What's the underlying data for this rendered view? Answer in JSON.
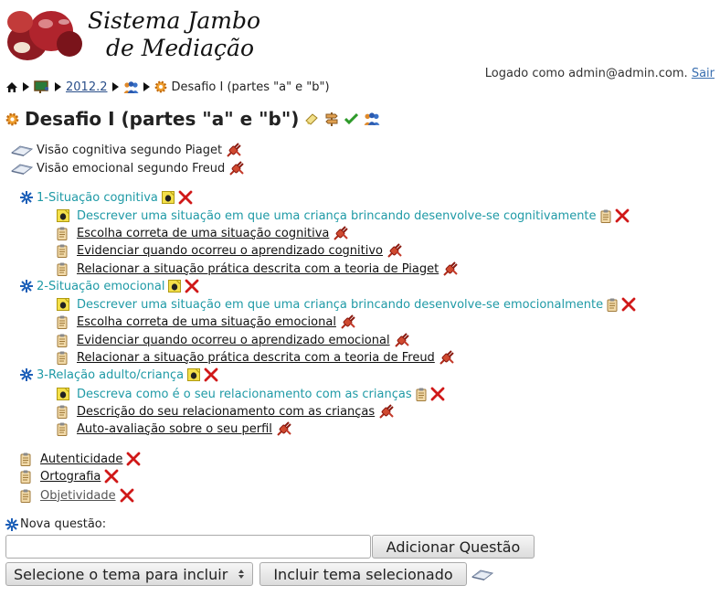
{
  "brand": {
    "line1": "Sistema Jambo",
    "line2": "de Mediação"
  },
  "login": {
    "text": "Logado como admin@admin.com.",
    "logout": "Sair"
  },
  "breadcrumb": {
    "semester": "2012.2",
    "current": "Desafio I (partes \"a\" e \"b\")"
  },
  "title": "Desafio I (partes \"a\" e \"b\")",
  "references": [
    {
      "label": "Visão cognitiva segundo Piaget"
    },
    {
      "label": "Visão emocional segundo Freud"
    }
  ],
  "situations": [
    {
      "label": "1-Situação cognitiva",
      "question": "Descrever uma situação em que uma criança brincando desenvolve-se cognitivamente",
      "criteria": [
        "Escolha correta de uma situação cognitiva",
        "Evidenciar quando ocorreu o aprendizado cognitivo",
        "Relacionar a situação prática descrita com a teoria de Piaget"
      ]
    },
    {
      "label": "2-Situação emocional",
      "question": "Descrever uma situação em que uma criança brincando desenvolve-se emocionalmente",
      "criteria": [
        "Escolha correta de uma situação emocional",
        "Evidenciar quando ocorreu o aprendizado emocional",
        "Relacionar a situação prática descrita com a teoria de Freud"
      ]
    },
    {
      "label": "3-Relação adulto/criança",
      "question": "Descreva como é o seu relacionamento com as crianças",
      "criteria": [
        "Descrição do seu relacionamento com as crianças",
        "Auto-avaliação sobre o seu perfil"
      ]
    }
  ],
  "general_criteria": [
    "Autenticidade",
    "Ortografia",
    "Objetividade"
  ],
  "form": {
    "new_question_label": "Nova questão:",
    "new_question_value": "",
    "add_button": "Adicionar Questão",
    "theme_select": "Selecione o tema para incluir",
    "include_button": "Incluir tema selecionado"
  },
  "icons": {
    "home": "home-icon",
    "classroom": "classroom-icon",
    "group": "group-icon",
    "gear": "gear-icon",
    "book": "book-icon",
    "plug": "plug-icon",
    "clipboard": "clipboard-icon",
    "note": "note-icon",
    "delete": "delete-icon",
    "star": "star-icon",
    "eraser": "eraser-icon",
    "signpost": "signpost-icon",
    "check": "check-icon"
  },
  "colors": {
    "accent_teal": "#1f9aa6",
    "delete_red": "#d01818",
    "plug_red": "#c43a2a",
    "star_blue": "#1c5fb8"
  }
}
